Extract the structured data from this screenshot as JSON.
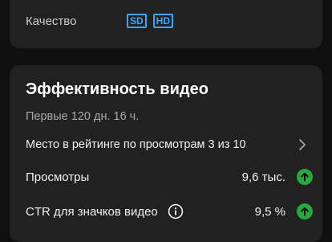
{
  "quality": {
    "label": "Качество",
    "badges": [
      "SD",
      "HD"
    ]
  },
  "performance": {
    "title": "Эффективность видео",
    "subtitle": "Первые 120 дн. 16 ч.",
    "rank_text": "Место в рейтинге по просмотрам 3 из 10",
    "metrics": [
      {
        "label": "Просмотры",
        "value": "9,6 тыс.",
        "trend": "up"
      },
      {
        "label": "CTR для значков видео",
        "value": "9,5 %",
        "trend": "up"
      }
    ]
  },
  "colors": {
    "accent_blue": "#3ea6ff",
    "trend_up_green": "#2ba640",
    "card_bg": "#212121",
    "page_bg": "#0f0f0f"
  },
  "icons": {
    "rank_chevron": "chevron-right-icon",
    "trend": "arrow-up-icon",
    "info": "info-icon"
  }
}
